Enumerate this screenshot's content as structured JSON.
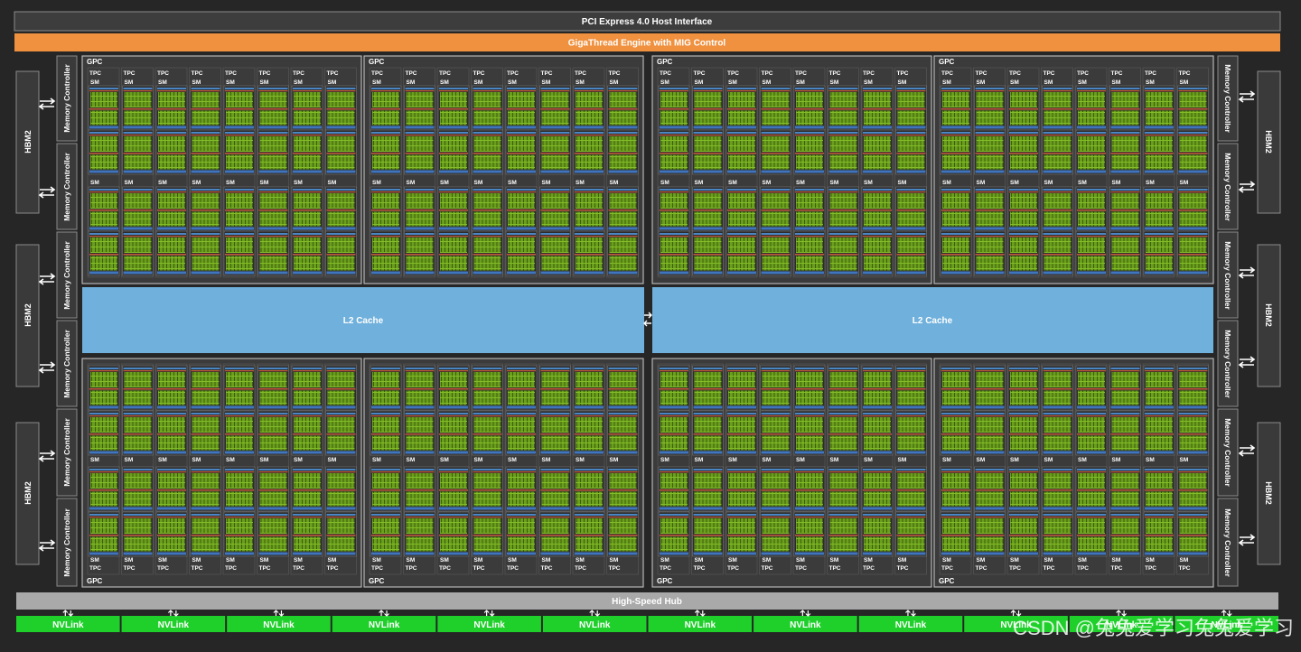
{
  "header": {
    "pcie_label": "PCI Express 4.0 Host Interface",
    "gigathread_label": "GigaThread Engine with MIG Control"
  },
  "hbm_label": "HBM2",
  "memory_controller_label": "Memory Controller",
  "gpc_label": "GPC",
  "tpc_label": "TPC",
  "sm_label": "SM",
  "l2_cache_label": "L2 Cache",
  "hub_label": "High-Speed Hub",
  "nvlink_label": "NVLink",
  "nvlink_count": 12,
  "watermark": "CSDN @兔兔爱学习兔兔爱学习",
  "colors": {
    "chip_background": "#262626",
    "pcie_bar": "#3d3d3d",
    "gigathread_bar": "#f0913f",
    "gpc_fill": "#3b3b3b",
    "sm_core_green": "#6a9f1b",
    "l2_cache": "#6fb0dc",
    "hub": "#a9a9a9",
    "nvlink": "#1fd02b"
  }
}
